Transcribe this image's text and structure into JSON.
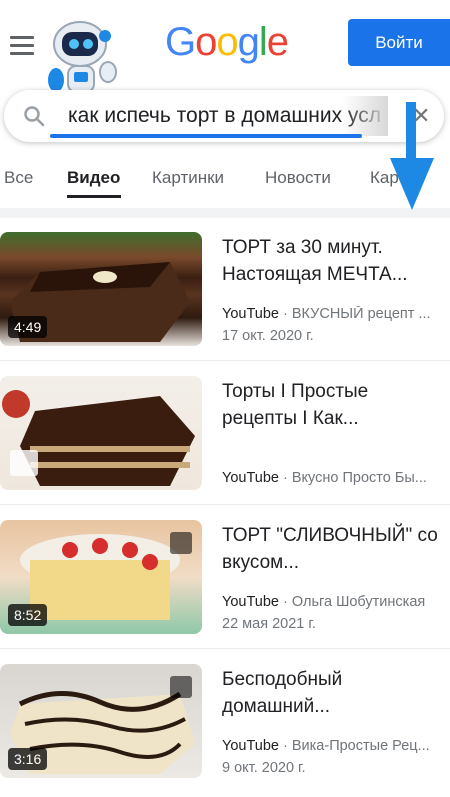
{
  "header": {
    "logo_letters": [
      "G",
      "o",
      "o",
      "g",
      "l",
      "e"
    ],
    "logo_colors": [
      "#4285F4",
      "#EA4335",
      "#FBBC05",
      "#4285F4",
      "#34A853",
      "#EA4335"
    ],
    "signin_label": "Войти"
  },
  "search": {
    "query": "как испечь торт в домашних усл"
  },
  "tabs": [
    {
      "label": "Все"
    },
    {
      "label": "Видео",
      "active": true
    },
    {
      "label": "Картинки"
    },
    {
      "label": "Новости"
    },
    {
      "label": "Карты"
    }
  ],
  "results": [
    {
      "title": "ТОРТ за 30 минут. Настоящая МЕЧТА...",
      "platform": "YouTube",
      "channel": "ВКУСНЫЙ рецепт ...",
      "date": "17 окт. 2020 г.",
      "duration": "4:49"
    },
    {
      "title": "Торты I Простые рецепты I Как...",
      "platform": "YouTube",
      "channel": "Вкусно Просто Бы...",
      "date": "",
      "duration": ""
    },
    {
      "title": "ТОРТ \"СЛИВОЧНЫЙ\" со вкусом...",
      "platform": "YouTube",
      "channel": "Ольга Шобутинская",
      "date": "22 мая 2021 г.",
      "duration": "8:52"
    },
    {
      "title": "Бесподобный домашний...",
      "platform": "YouTube",
      "channel": "Вика-Простые Рец...",
      "date": "9 окт. 2020 г.",
      "duration": "3:16"
    }
  ],
  "colors": {
    "accent": "#1a73e8",
    "arrow": "#1e88e5"
  }
}
